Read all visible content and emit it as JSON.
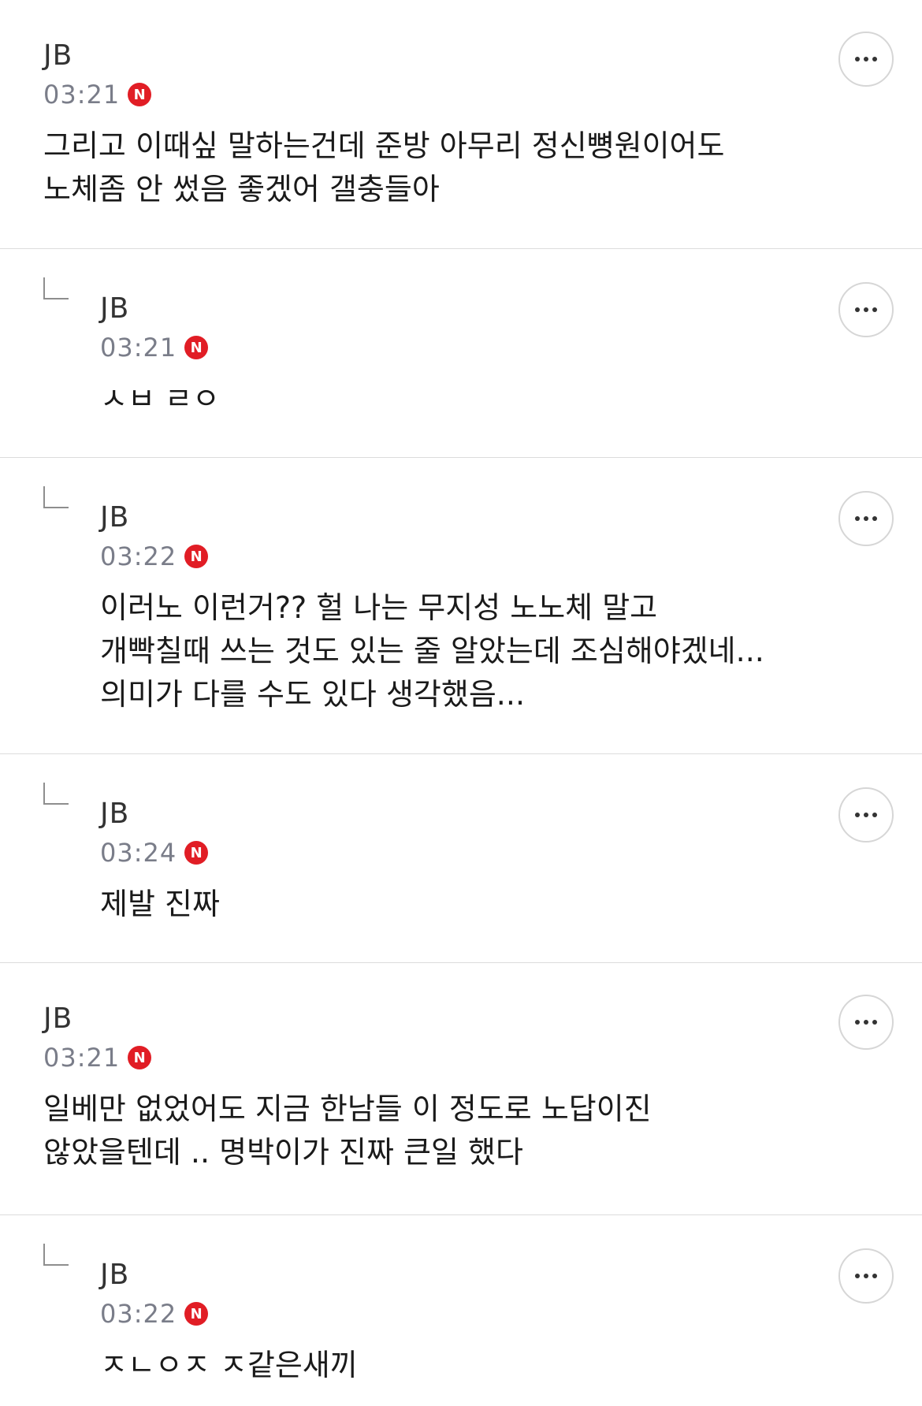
{
  "comments": [
    {
      "author": "JB",
      "time": "03:21",
      "badge": "N",
      "text": "그리고 이때싶 말하는건데 준방 아무리 정신뼝원이어도 노체좀 안 썼음 좋겠어 갤충들아",
      "reply": false
    },
    {
      "author": "JB",
      "time": "03:21",
      "badge": "N",
      "text": "ㅅㅂ ㄹㅇ",
      "reply": true
    },
    {
      "author": "JB",
      "time": "03:22",
      "badge": "N",
      "text": "이러노 이런거?? 헐 나는 무지성 노노체 말고 개빡칠때 쓰는 것도 있는 줄 알았는데 조심해야겠네... 의미가 다를 수도 있다 생각했음...",
      "reply": true
    },
    {
      "author": "JB",
      "time": "03:24",
      "badge": "N",
      "text": "제발 진짜",
      "reply": true
    },
    {
      "author": "JB",
      "time": "03:21",
      "badge": "N",
      "text": "일베만 없었어도 지금 한남들 이 정도로 노답이진 않았을텐데 .. 명박이가 진짜 큰일 했다",
      "reply": false
    },
    {
      "author": "JB",
      "time": "03:22",
      "badge": "N",
      "text": "ㅈㄴㅇㅈ ㅈ같은새끼",
      "reply": true
    }
  ],
  "icons": {
    "more": "more-horizontal-icon",
    "reply": "reply-arrow-icon",
    "new_badge": "new-badge-icon"
  },
  "colors": {
    "badge": "#e11d25",
    "time": "#7a7d89",
    "divider": "#dcdcdc"
  }
}
